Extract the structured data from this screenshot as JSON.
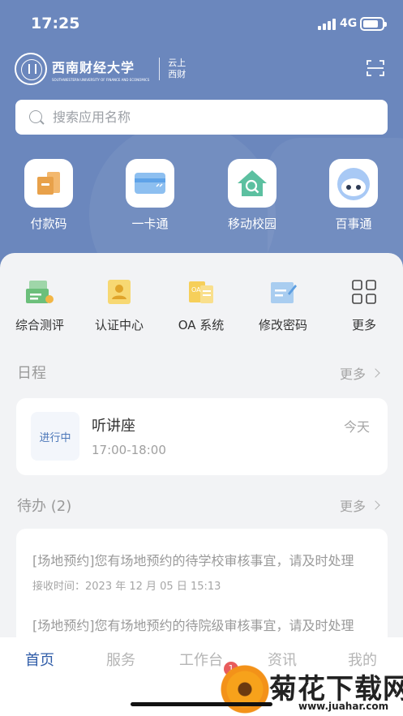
{
  "status_bar": {
    "time": "17:25",
    "network": "4G",
    "battery_level": 0.8
  },
  "header": {
    "university_name": "西南财经大学",
    "university_name_en": "SOUTHWESTERN UNIVERSITY OF FINANCE AND ECONOMICS",
    "app_name": "云上西财"
  },
  "search": {
    "placeholder": "搜索应用名称"
  },
  "quick_apps": [
    {
      "label": "付款码",
      "icon": "payment-code-icon"
    },
    {
      "label": "一卡通",
      "icon": "campus-card-icon"
    },
    {
      "label": "移动校园",
      "icon": "mobile-campus-icon"
    },
    {
      "label": "百事通",
      "icon": "assistant-robot-icon"
    }
  ],
  "services": [
    {
      "label": "综合测评",
      "icon": "evaluation-icon",
      "color": "#7cc08a"
    },
    {
      "label": "认证中心",
      "icon": "certification-icon",
      "color": "#f0c044"
    },
    {
      "label": "OA 系统",
      "icon": "oa-system-icon",
      "color": "#f0c85a"
    },
    {
      "label": "修改密码",
      "icon": "change-password-icon",
      "color": "#7ab0e0"
    },
    {
      "label": "更多",
      "icon": "more-grid-icon",
      "color": "#444444"
    }
  ],
  "schedule": {
    "title": "日程",
    "more": "更多",
    "item": {
      "status": "进行中",
      "name": "听讲座",
      "time": "17:00-18:00",
      "day": "今天"
    }
  },
  "todo": {
    "title": "待办 (2)",
    "more": "更多",
    "items": [
      {
        "text": "[场地预约]您有场地预约的待学校审核事宜，请及时处理",
        "received": "接收时间：2023 年 12 月 05 日 15:13"
      },
      {
        "text": "[场地预约]您有场地预约的待院级审核事宜，请及时处理",
        "received": ""
      }
    ]
  },
  "tabs": [
    {
      "label": "首页",
      "active": true
    },
    {
      "label": "服务",
      "active": false
    },
    {
      "label": "工作台",
      "active": false,
      "badge": "1"
    },
    {
      "label": "资讯",
      "active": false
    },
    {
      "label": "我的",
      "active": false
    }
  ],
  "watermark": {
    "text": "菊花下载网",
    "url": "www.juahar.com"
  }
}
